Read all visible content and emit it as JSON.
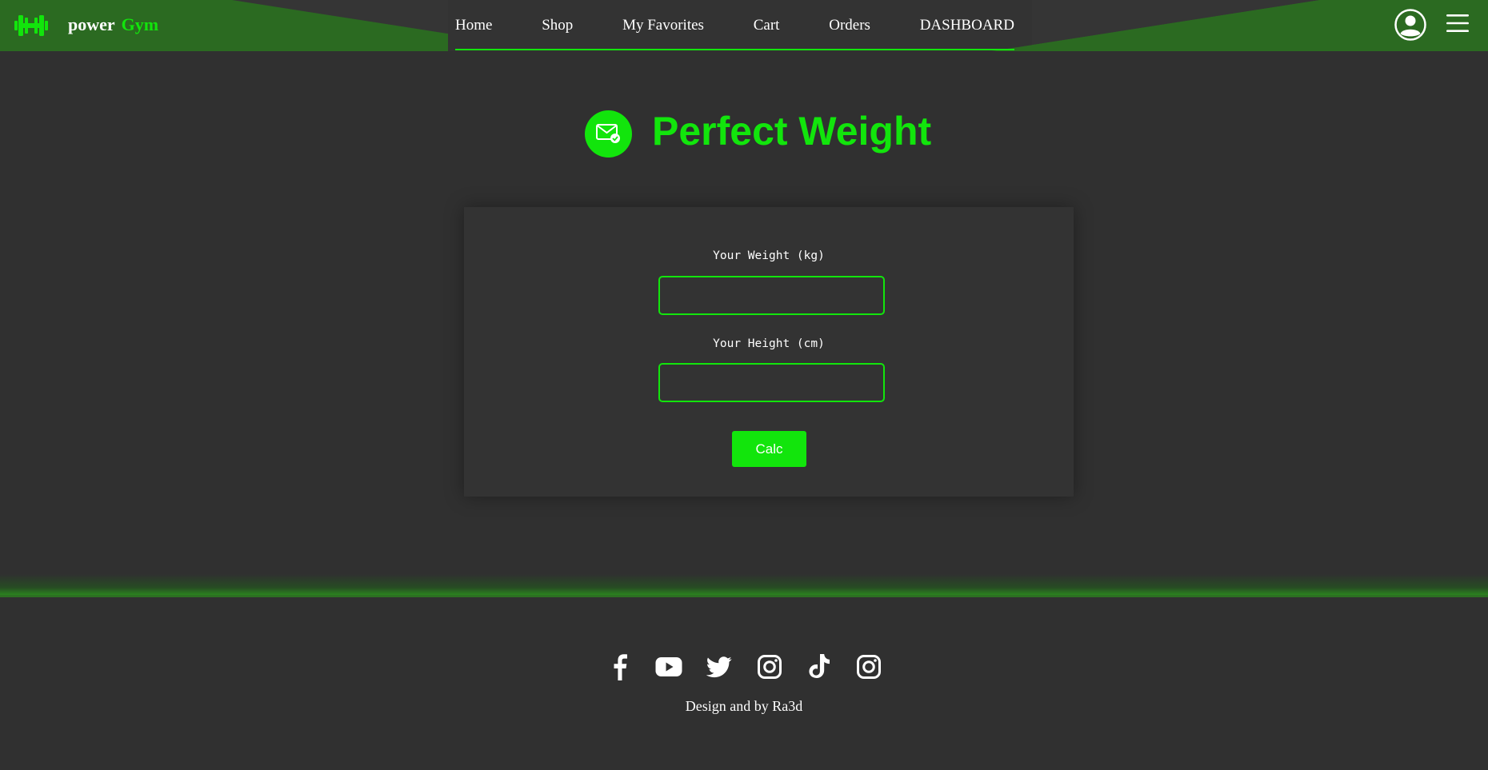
{
  "brand": {
    "word1": "power",
    "word2": "Gym"
  },
  "nav": {
    "items": [
      {
        "label": "Home"
      },
      {
        "label": "Shop"
      },
      {
        "label": "My Favorites"
      },
      {
        "label": "Cart"
      },
      {
        "label": "Orders"
      },
      {
        "label": "DASHBOARD"
      }
    ]
  },
  "header_icons": {
    "user": "user-circle-icon",
    "menu": "hamburger-menu-icon"
  },
  "page": {
    "title": "Perfect Weight",
    "title_icon": "mail-check-icon"
  },
  "form": {
    "weight_label": "Your Weight (kg)",
    "weight_value": "",
    "height_label": "Your Height (cm)",
    "height_value": "",
    "submit_label": "Calc"
  },
  "footer": {
    "socials": [
      {
        "name": "facebook-icon"
      },
      {
        "name": "youtube-icon"
      },
      {
        "name": "twitter-icon"
      },
      {
        "name": "instagram-icon"
      },
      {
        "name": "tiktok-icon"
      },
      {
        "name": "instagram-icon"
      }
    ],
    "credit": "Design and by Ra3d"
  },
  "colors": {
    "accent": "#12e50c",
    "header_bg": "#2c7022",
    "page_bg": "#303030",
    "card_bg": "#333333"
  }
}
